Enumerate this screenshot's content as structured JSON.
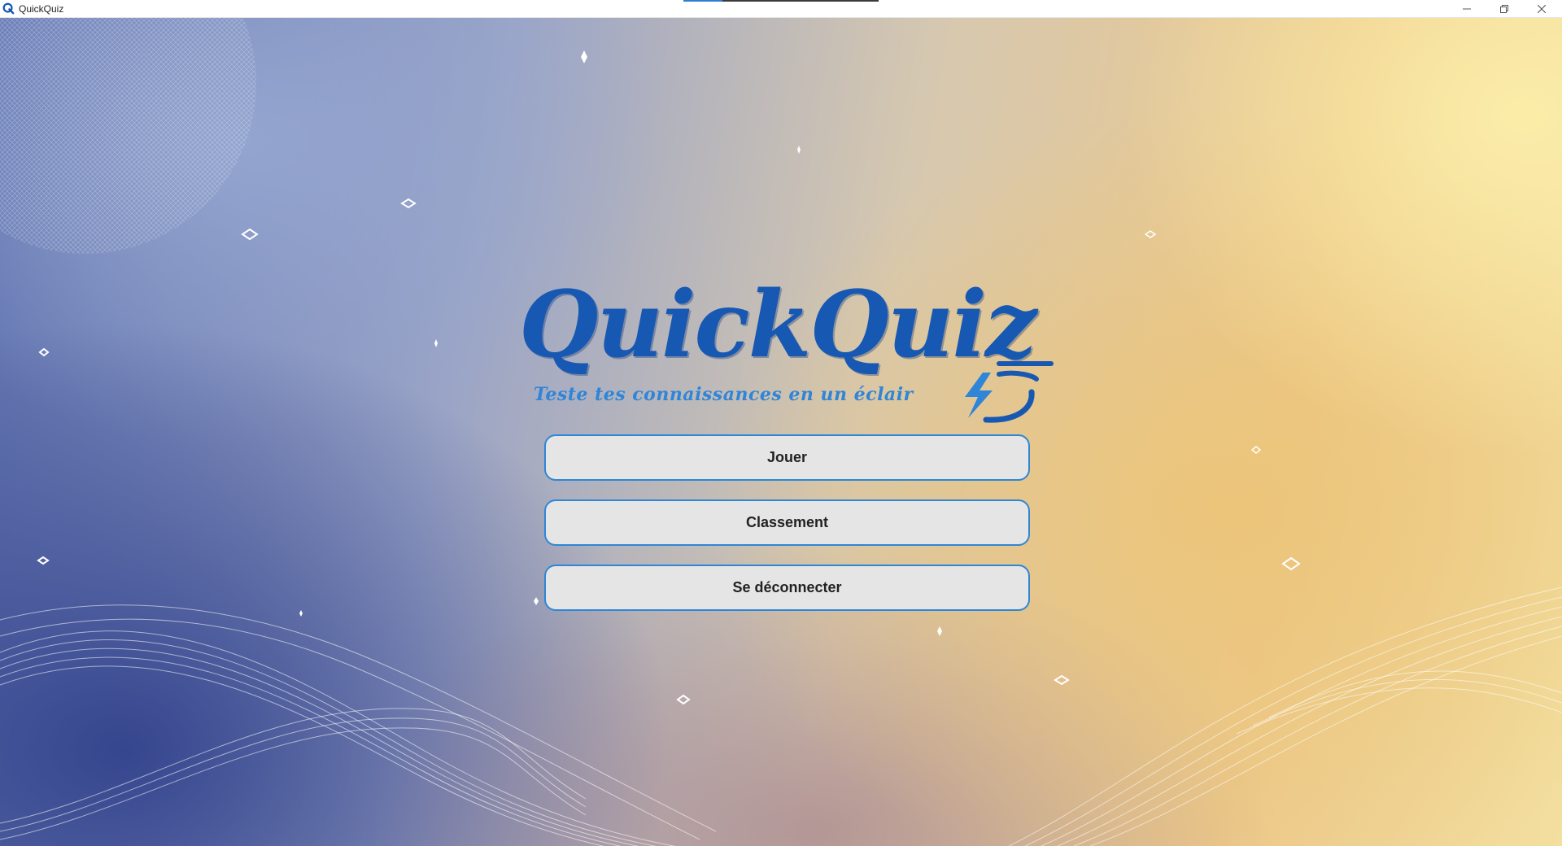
{
  "window": {
    "title": "QuickQuiz",
    "title_bar_controls": [
      "minimize-icon",
      "restore-icon",
      "close-icon"
    ],
    "loading_progress": 0.2
  },
  "logo": {
    "title": "QuickQuiz",
    "tagline": "Teste tes connaissances en un éclair",
    "icon": "lightning-bolt-icon",
    "color": "#1758b3",
    "tagline_color": "#2f85d8"
  },
  "menu": {
    "items": [
      {
        "label": "Jouer"
      },
      {
        "label": "Classement"
      },
      {
        "label": "Se déconnecter"
      }
    ],
    "button_background": "#e5e5e5",
    "button_border": "#2f86d6"
  },
  "theme": {
    "background_left": "#3b4a8c",
    "background_right": "#f3dfa0"
  }
}
